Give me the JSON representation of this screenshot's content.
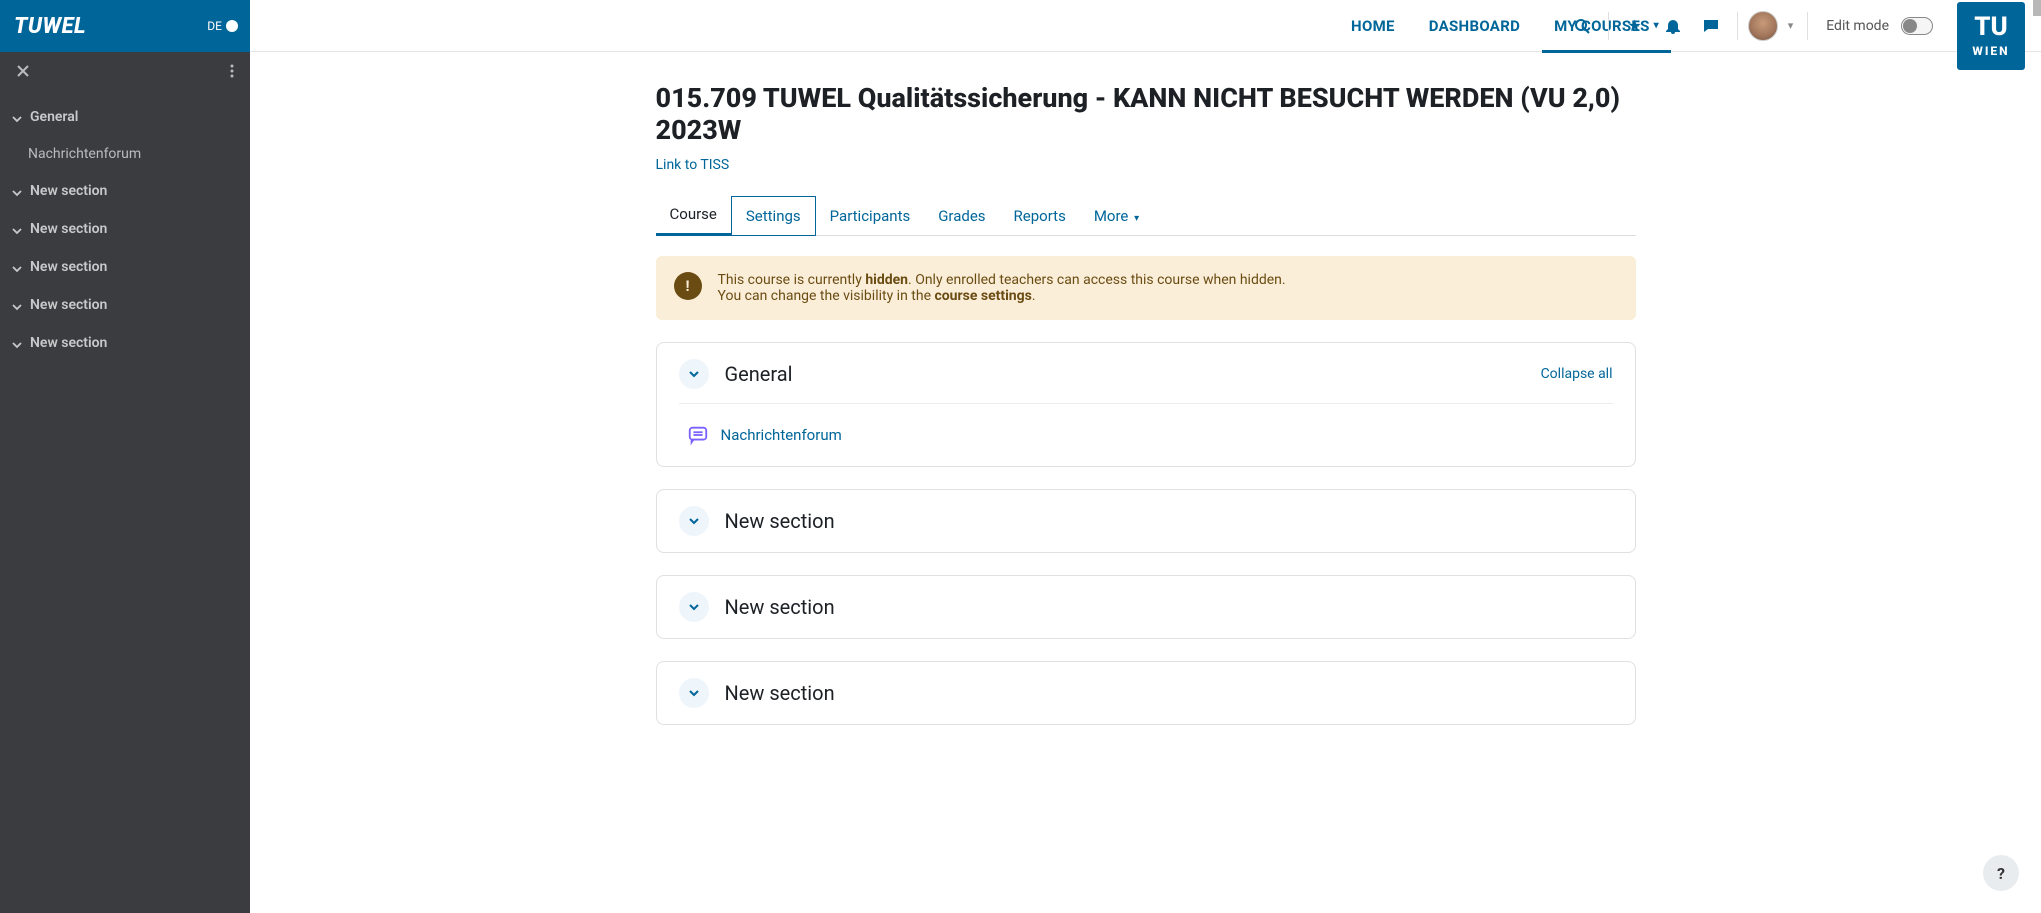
{
  "brand": {
    "name": "TUWEL",
    "lang": "DE"
  },
  "topnav": {
    "home": "HOME",
    "dashboard": "DASHBOARD",
    "mycourses": "MY COURSES",
    "edit_mode": "Edit mode"
  },
  "tu_logo": {
    "top": "TU",
    "bottom": "WIEN"
  },
  "sidebar": {
    "items": [
      {
        "label": "General"
      },
      {
        "label": "New section"
      },
      {
        "label": "New section"
      },
      {
        "label": "New section"
      },
      {
        "label": "New section"
      },
      {
        "label": "New section"
      }
    ],
    "subitem": "Nachrichtenforum"
  },
  "page": {
    "title": "015.709 TUWEL Qualitätssicherung - KANN NICHT BESUCHT WERDEN (VU 2,0) 2023W",
    "tiss_link": "Link to TISS"
  },
  "tabs": {
    "course": "Course",
    "settings": "Settings",
    "participants": "Participants",
    "grades": "Grades",
    "reports": "Reports",
    "more": "More"
  },
  "alert": {
    "line1_pre": "This course is currently ",
    "line1_bold": "hidden",
    "line1_post": ". Only enrolled teachers can access this course when hidden.",
    "line2_pre": "You can change the visibility in the ",
    "line2_bold": "course settings",
    "line2_post": "."
  },
  "sections": {
    "collapse_all": "Collapse all",
    "general": {
      "title": "General",
      "activity": "Nachrichtenforum"
    },
    "others": [
      {
        "title": "New section"
      },
      {
        "title": "New section"
      },
      {
        "title": "New section"
      }
    ]
  },
  "help": "?"
}
